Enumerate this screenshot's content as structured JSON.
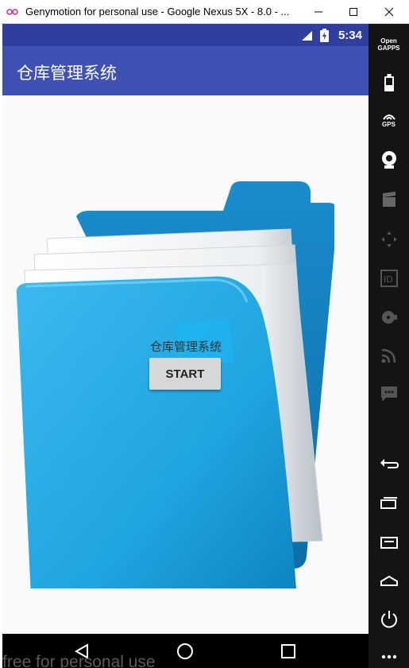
{
  "window": {
    "title": "Genymotion for personal use - Google Nexus 5X - 8.0 - ...",
    "logo_icon": "genymotion-logo-icon",
    "controls": [
      "minimize-icon",
      "maximize-icon",
      "close-icon"
    ]
  },
  "statusbar": {
    "time": "5:34",
    "icons": [
      "signal-icon",
      "battery-icon"
    ],
    "color": "#303f9f"
  },
  "appbar": {
    "title": "仓库管理系统",
    "color": "#3f51b5"
  },
  "main": {
    "label": "仓库管理系统",
    "start_button": "START",
    "background_image": "folder-illustration"
  },
  "navbar": {
    "buttons": [
      "back-icon",
      "home-icon",
      "recents-icon"
    ],
    "watermark": "free for personal use"
  },
  "side_panel": {
    "opengapps_label": "Open\nGAPPS",
    "gps_label": "GPS",
    "tools": [
      "opengapps-icon",
      "battery-icon",
      "gps-icon",
      "webcam-icon",
      "video-icon",
      "dpad-icon",
      "id-icon",
      "disk-icon",
      "cast-icon",
      "sms-icon",
      "back-icon",
      "recents-icon",
      "menu-icon",
      "home-icon",
      "power-icon",
      "more-icon"
    ]
  }
}
